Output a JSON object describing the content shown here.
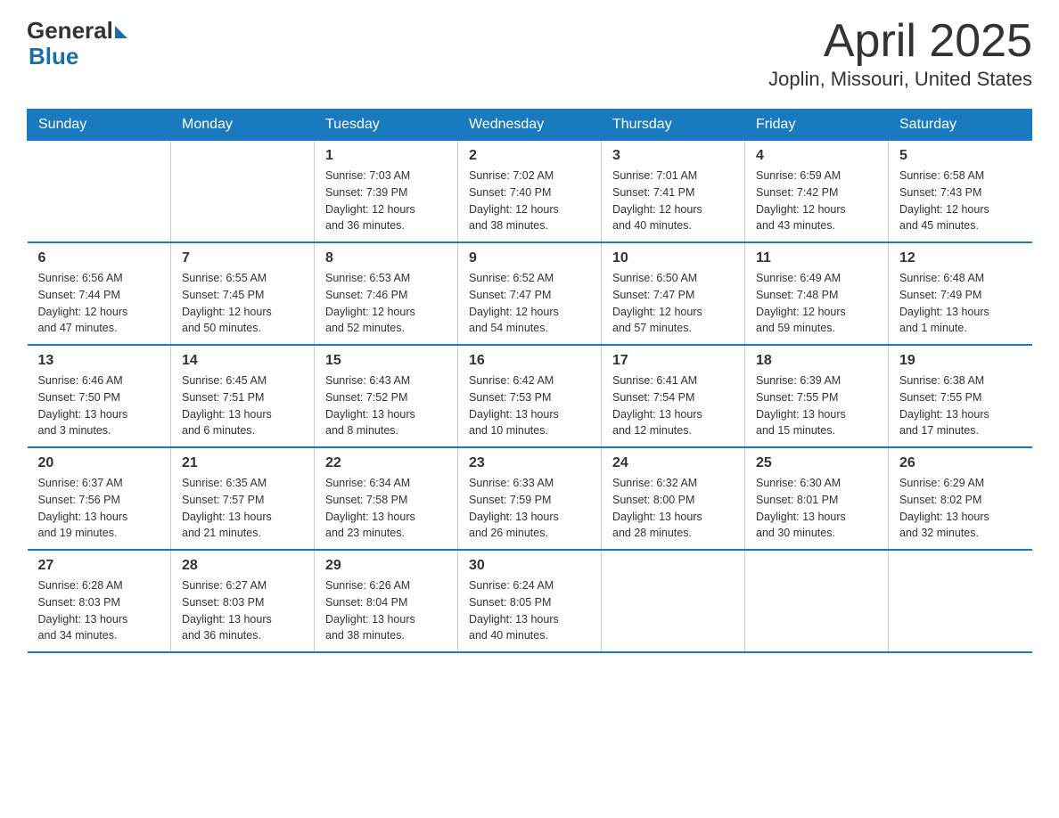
{
  "header": {
    "logo_general": "General",
    "logo_blue": "Blue",
    "month_title": "April 2025",
    "location": "Joplin, Missouri, United States"
  },
  "days_of_week": [
    "Sunday",
    "Monday",
    "Tuesday",
    "Wednesday",
    "Thursday",
    "Friday",
    "Saturday"
  ],
  "weeks": [
    [
      {
        "day": "",
        "info": ""
      },
      {
        "day": "",
        "info": ""
      },
      {
        "day": "1",
        "info": "Sunrise: 7:03 AM\nSunset: 7:39 PM\nDaylight: 12 hours\nand 36 minutes."
      },
      {
        "day": "2",
        "info": "Sunrise: 7:02 AM\nSunset: 7:40 PM\nDaylight: 12 hours\nand 38 minutes."
      },
      {
        "day": "3",
        "info": "Sunrise: 7:01 AM\nSunset: 7:41 PM\nDaylight: 12 hours\nand 40 minutes."
      },
      {
        "day": "4",
        "info": "Sunrise: 6:59 AM\nSunset: 7:42 PM\nDaylight: 12 hours\nand 43 minutes."
      },
      {
        "day": "5",
        "info": "Sunrise: 6:58 AM\nSunset: 7:43 PM\nDaylight: 12 hours\nand 45 minutes."
      }
    ],
    [
      {
        "day": "6",
        "info": "Sunrise: 6:56 AM\nSunset: 7:44 PM\nDaylight: 12 hours\nand 47 minutes."
      },
      {
        "day": "7",
        "info": "Sunrise: 6:55 AM\nSunset: 7:45 PM\nDaylight: 12 hours\nand 50 minutes."
      },
      {
        "day": "8",
        "info": "Sunrise: 6:53 AM\nSunset: 7:46 PM\nDaylight: 12 hours\nand 52 minutes."
      },
      {
        "day": "9",
        "info": "Sunrise: 6:52 AM\nSunset: 7:47 PM\nDaylight: 12 hours\nand 54 minutes."
      },
      {
        "day": "10",
        "info": "Sunrise: 6:50 AM\nSunset: 7:47 PM\nDaylight: 12 hours\nand 57 minutes."
      },
      {
        "day": "11",
        "info": "Sunrise: 6:49 AM\nSunset: 7:48 PM\nDaylight: 12 hours\nand 59 minutes."
      },
      {
        "day": "12",
        "info": "Sunrise: 6:48 AM\nSunset: 7:49 PM\nDaylight: 13 hours\nand 1 minute."
      }
    ],
    [
      {
        "day": "13",
        "info": "Sunrise: 6:46 AM\nSunset: 7:50 PM\nDaylight: 13 hours\nand 3 minutes."
      },
      {
        "day": "14",
        "info": "Sunrise: 6:45 AM\nSunset: 7:51 PM\nDaylight: 13 hours\nand 6 minutes."
      },
      {
        "day": "15",
        "info": "Sunrise: 6:43 AM\nSunset: 7:52 PM\nDaylight: 13 hours\nand 8 minutes."
      },
      {
        "day": "16",
        "info": "Sunrise: 6:42 AM\nSunset: 7:53 PM\nDaylight: 13 hours\nand 10 minutes."
      },
      {
        "day": "17",
        "info": "Sunrise: 6:41 AM\nSunset: 7:54 PM\nDaylight: 13 hours\nand 12 minutes."
      },
      {
        "day": "18",
        "info": "Sunrise: 6:39 AM\nSunset: 7:55 PM\nDaylight: 13 hours\nand 15 minutes."
      },
      {
        "day": "19",
        "info": "Sunrise: 6:38 AM\nSunset: 7:55 PM\nDaylight: 13 hours\nand 17 minutes."
      }
    ],
    [
      {
        "day": "20",
        "info": "Sunrise: 6:37 AM\nSunset: 7:56 PM\nDaylight: 13 hours\nand 19 minutes."
      },
      {
        "day": "21",
        "info": "Sunrise: 6:35 AM\nSunset: 7:57 PM\nDaylight: 13 hours\nand 21 minutes."
      },
      {
        "day": "22",
        "info": "Sunrise: 6:34 AM\nSunset: 7:58 PM\nDaylight: 13 hours\nand 23 minutes."
      },
      {
        "day": "23",
        "info": "Sunrise: 6:33 AM\nSunset: 7:59 PM\nDaylight: 13 hours\nand 26 minutes."
      },
      {
        "day": "24",
        "info": "Sunrise: 6:32 AM\nSunset: 8:00 PM\nDaylight: 13 hours\nand 28 minutes."
      },
      {
        "day": "25",
        "info": "Sunrise: 6:30 AM\nSunset: 8:01 PM\nDaylight: 13 hours\nand 30 minutes."
      },
      {
        "day": "26",
        "info": "Sunrise: 6:29 AM\nSunset: 8:02 PM\nDaylight: 13 hours\nand 32 minutes."
      }
    ],
    [
      {
        "day": "27",
        "info": "Sunrise: 6:28 AM\nSunset: 8:03 PM\nDaylight: 13 hours\nand 34 minutes."
      },
      {
        "day": "28",
        "info": "Sunrise: 6:27 AM\nSunset: 8:03 PM\nDaylight: 13 hours\nand 36 minutes."
      },
      {
        "day": "29",
        "info": "Sunrise: 6:26 AM\nSunset: 8:04 PM\nDaylight: 13 hours\nand 38 minutes."
      },
      {
        "day": "30",
        "info": "Sunrise: 6:24 AM\nSunset: 8:05 PM\nDaylight: 13 hours\nand 40 minutes."
      },
      {
        "day": "",
        "info": ""
      },
      {
        "day": "",
        "info": ""
      },
      {
        "day": "",
        "info": ""
      }
    ]
  ]
}
